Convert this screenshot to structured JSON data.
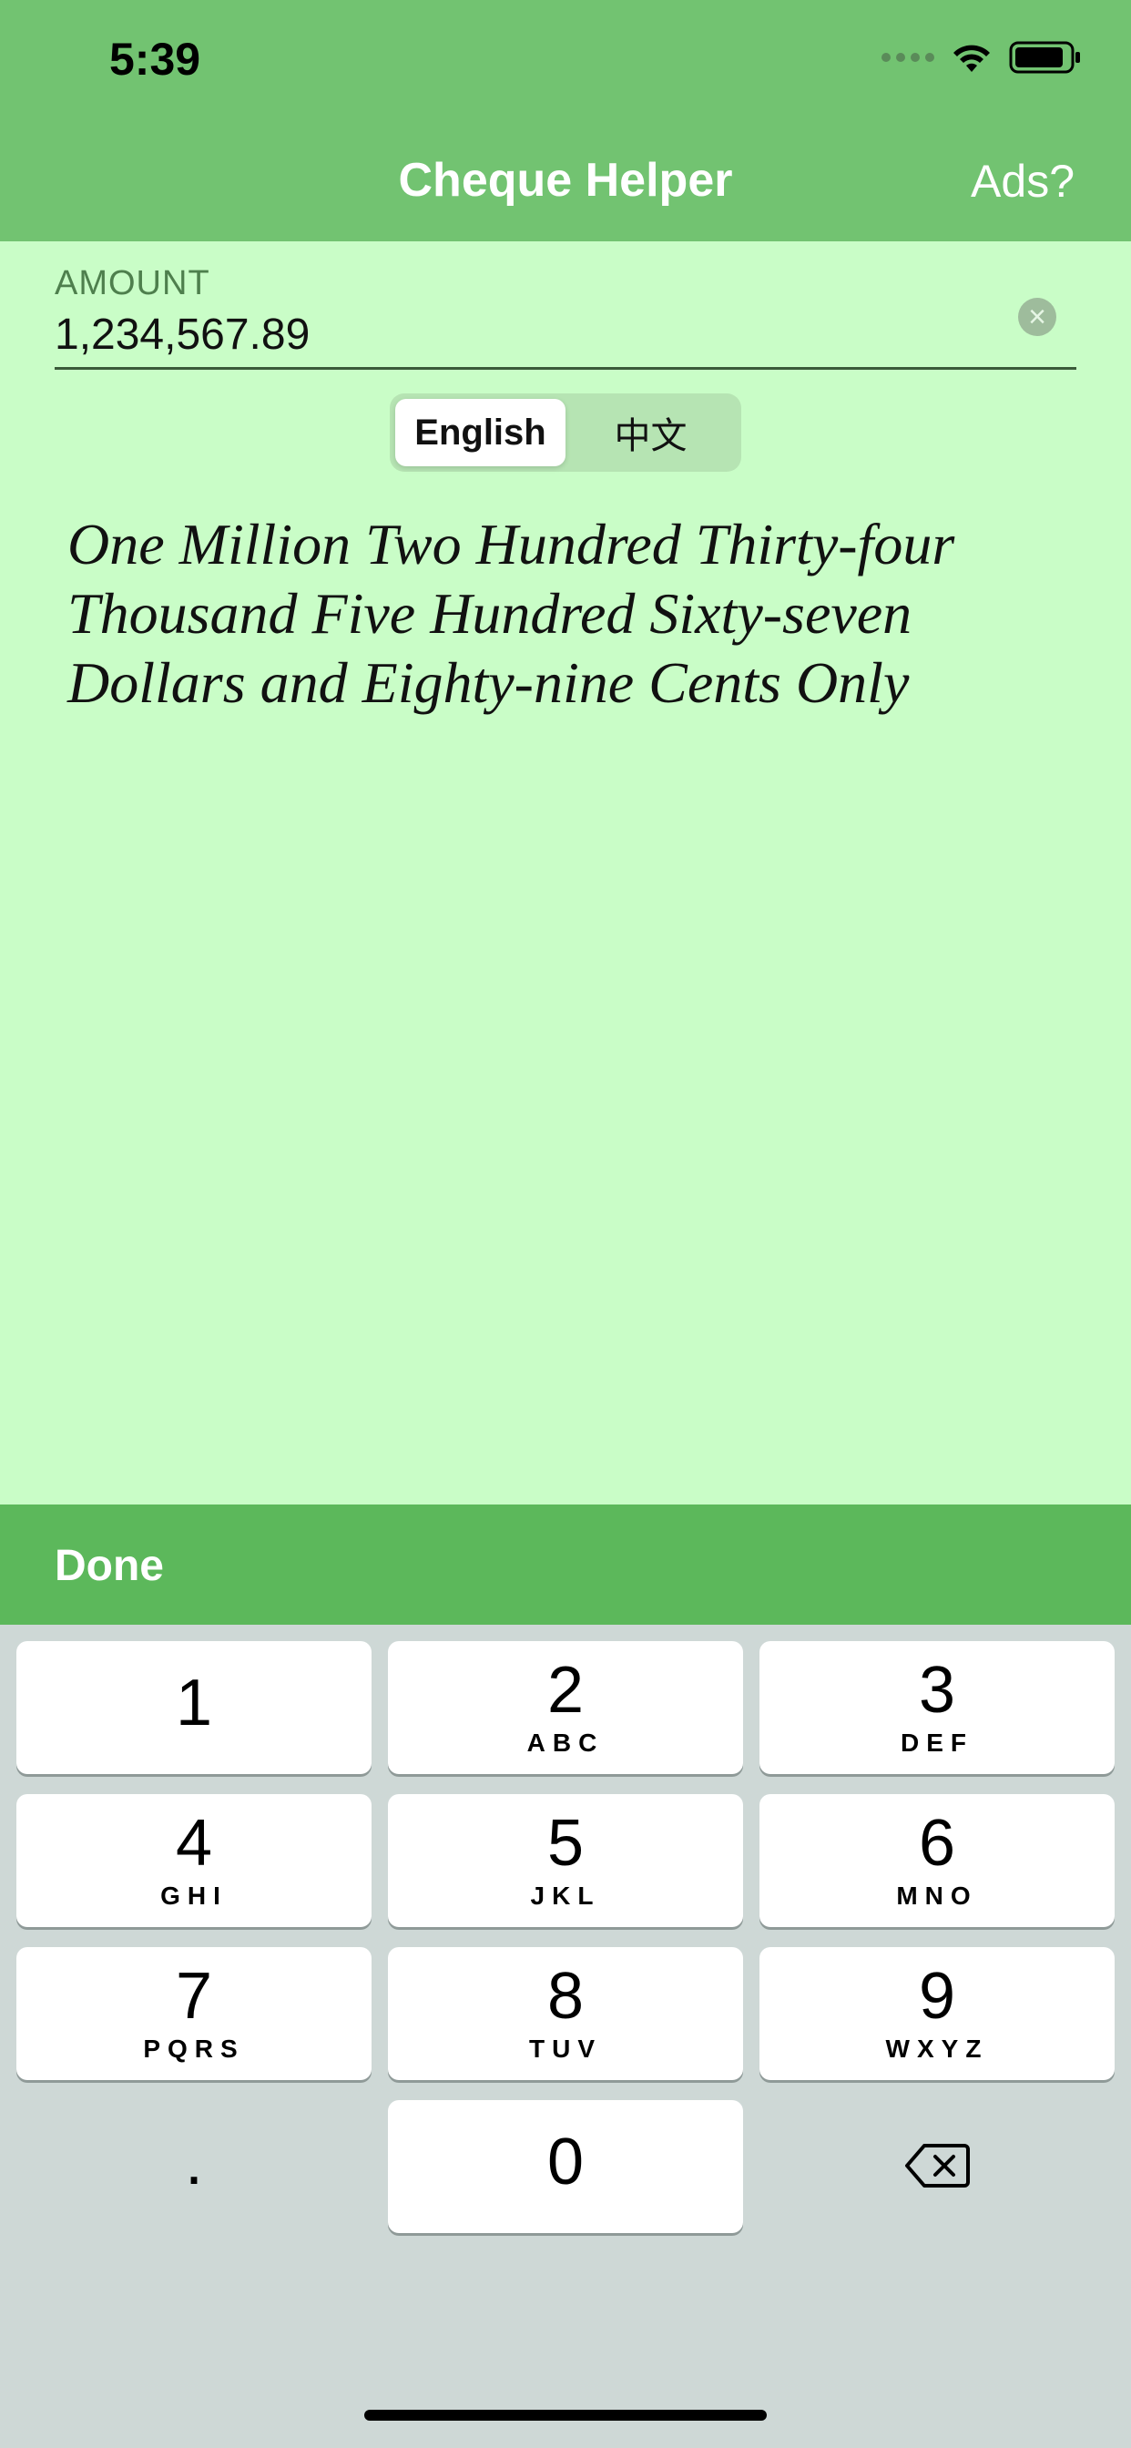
{
  "status_bar": {
    "time": "5:39"
  },
  "header": {
    "title": "Cheque Helper",
    "ads_label": "Ads?"
  },
  "amount": {
    "label": "AMOUNT",
    "value": "1,234,567.89",
    "clear_icon": "clear-circle-icon"
  },
  "language_toggle": {
    "options": [
      "English",
      "中文"
    ],
    "selected": "English"
  },
  "amount_in_words": "One Million Two Hundred Thirty-four Thousand Five Hundred Sixty-seven Dollars and Eighty-nine Cents Only",
  "toolbar": {
    "done_label": "Done"
  },
  "keypad": {
    "keys": [
      {
        "digit": "1",
        "letters": ""
      },
      {
        "digit": "2",
        "letters": "ABC"
      },
      {
        "digit": "3",
        "letters": "DEF"
      },
      {
        "digit": "4",
        "letters": "GHI"
      },
      {
        "digit": "5",
        "letters": "JKL"
      },
      {
        "digit": "6",
        "letters": "MNO"
      },
      {
        "digit": "7",
        "letters": "PQRS"
      },
      {
        "digit": "8",
        "letters": "TUV"
      },
      {
        "digit": "9",
        "letters": "WXYZ"
      },
      {
        "digit": ".",
        "letters": ""
      },
      {
        "digit": "0",
        "letters": ""
      }
    ],
    "delete_icon": "backspace-icon"
  },
  "colors": {
    "header_bg": "#72c371",
    "page_bg": "#c9fdc7",
    "toolbar_bg": "#5cb85b",
    "keyboard_bg": "#ced8d6"
  }
}
